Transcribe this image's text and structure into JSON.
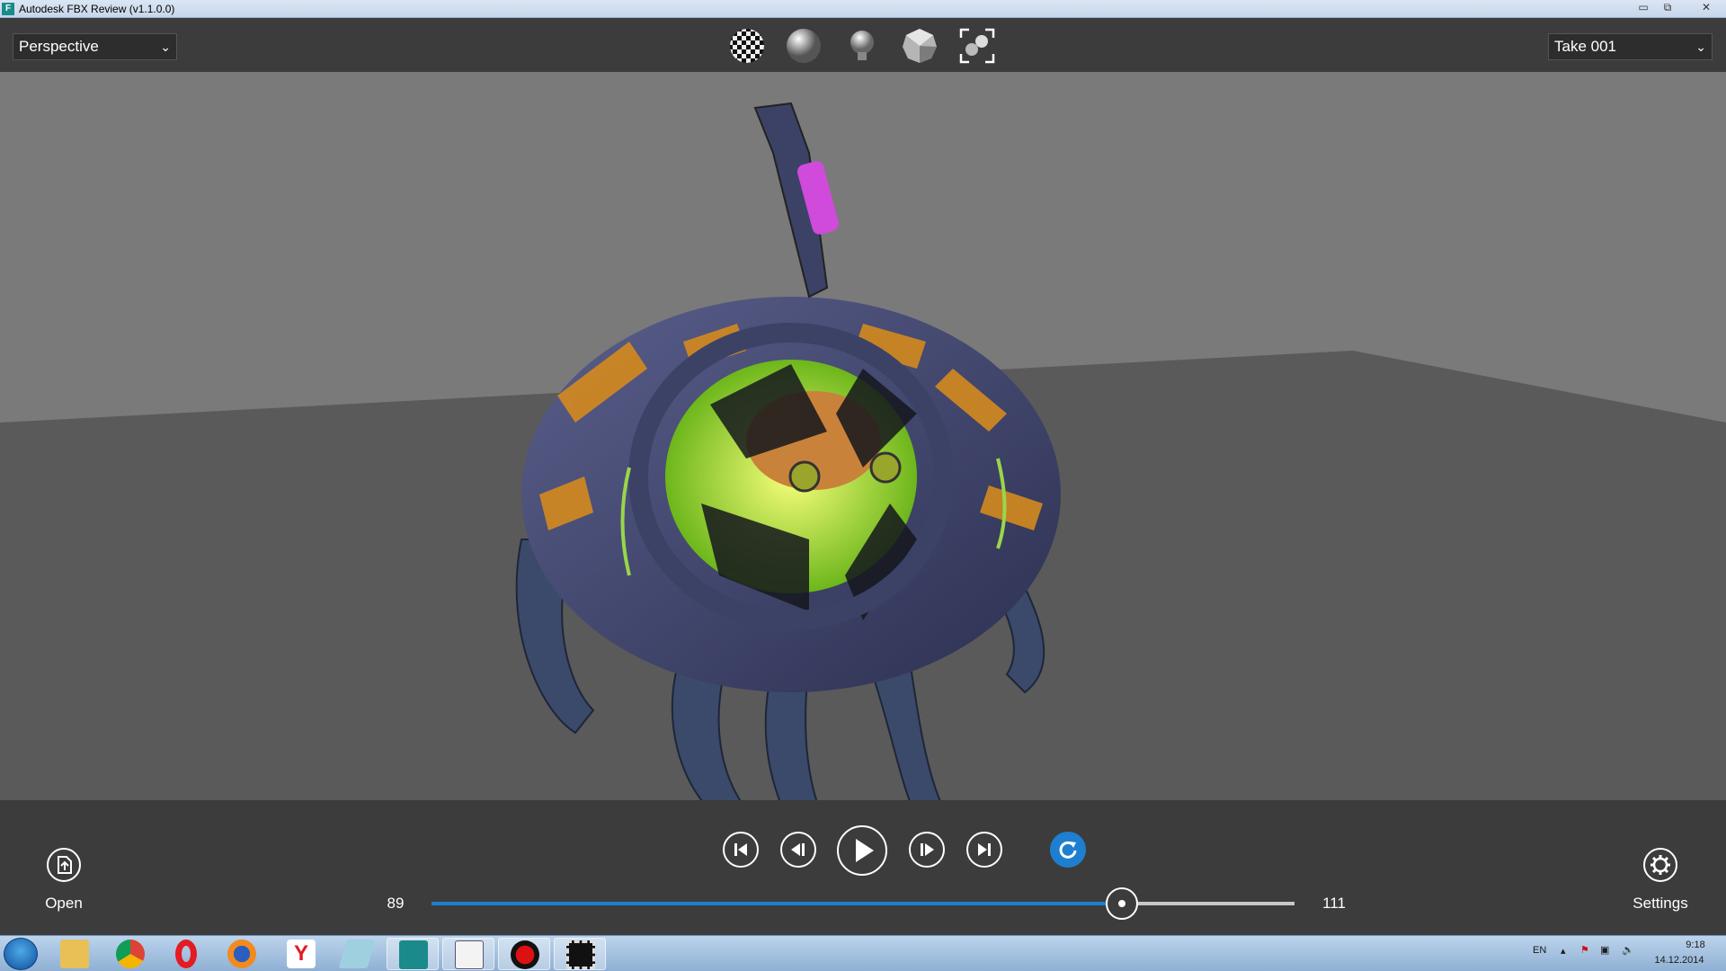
{
  "window": {
    "title": "Autodesk FBX Review (v1.1.0.0)",
    "app_icon": "F",
    "buttons": {
      "minimize": "▭",
      "restore": "⧉",
      "close": "✕"
    }
  },
  "toolbar": {
    "camera_select": {
      "value": "Perspective"
    },
    "take_select": {
      "value": "Take 001"
    },
    "tools": [
      "checker-shading-icon",
      "smooth-shading-icon",
      "light-bulb-icon",
      "faceted-shading-icon",
      "multi-object-icon"
    ]
  },
  "playback": {
    "start_frame": "89",
    "end_frame": "111",
    "current_fraction": 0.8,
    "open_label": "Open",
    "settings_label": "Settings"
  },
  "taskbar": {
    "apps": [
      "explorer-icon",
      "chrome-icon",
      "opera-icon",
      "firefox-icon",
      "yandex-icon",
      "notepad-icon",
      "fbx-review-icon",
      "paint-icon",
      "record-icon",
      "filmstrip-icon"
    ],
    "language": "EN",
    "time": "9:18",
    "date": "14.12.2014"
  },
  "colors": {
    "accent": "#1e7fd0",
    "panel": "#3c3c3c",
    "viewport_bg": "#7a7a7a",
    "floor": "#5a5a5a"
  }
}
